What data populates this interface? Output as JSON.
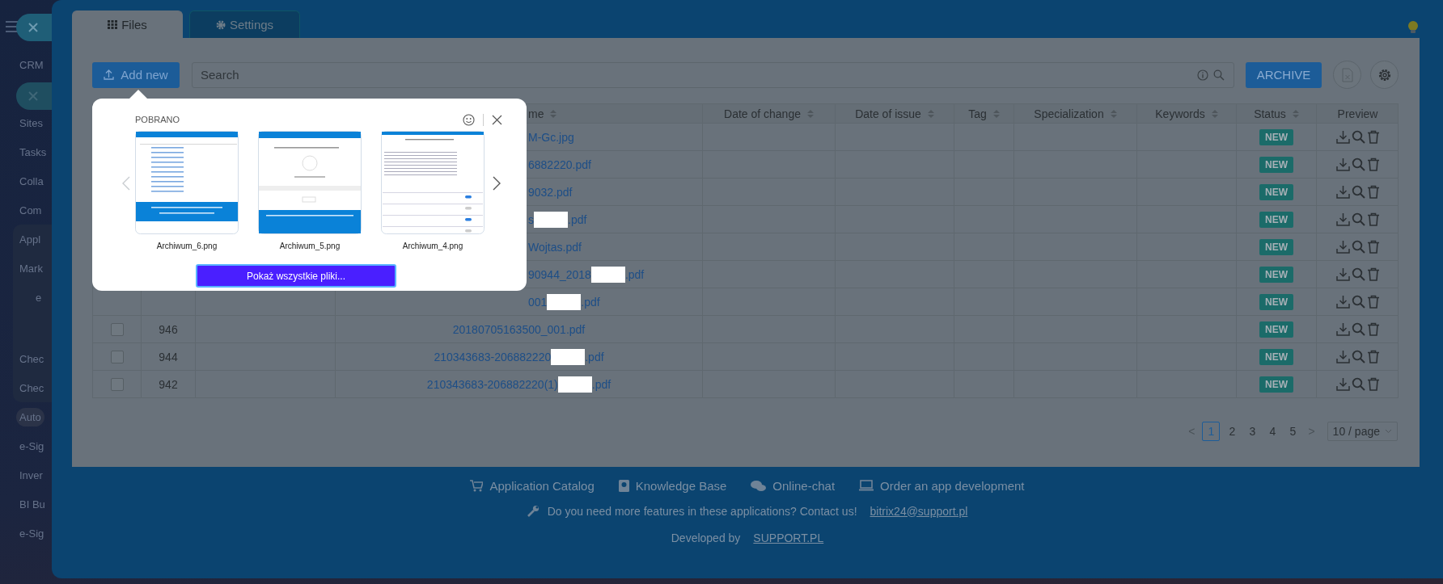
{
  "sidebar": {
    "items": [
      {
        "label": "CRM",
        "selected": false
      },
      {
        "label": "Sites",
        "selected": false
      },
      {
        "label": "Tasks",
        "selected": false
      },
      {
        "label": "Colla",
        "selected": false
      },
      {
        "label": "Com",
        "selected": false
      }
    ],
    "group": [
      {
        "label": "Appl",
        "kind": "item",
        "selected": false
      },
      {
        "label": "Mark",
        "kind": "item",
        "selected": false
      },
      {
        "label": "e",
        "kind": "sub",
        "selected": false
      },
      {
        "label": "Chec",
        "kind": "item",
        "selected": false
      },
      {
        "label": "Chec",
        "kind": "item",
        "selected": false
      }
    ],
    "items_after": [
      {
        "label": "Auto",
        "selected": true
      },
      {
        "label": "e-Sig",
        "selected": false
      },
      {
        "label": "Inver",
        "selected": false
      },
      {
        "label": "BI Bu",
        "selected": false
      },
      {
        "label": "e-Sig",
        "selected": false
      }
    ]
  },
  "tabs": [
    {
      "label": "Files",
      "selected": true
    },
    {
      "label": "Settings",
      "selected": false
    }
  ],
  "toolbar": {
    "add_button": "Add new",
    "search": {
      "placeholder": "Search"
    },
    "archive_button": "ARCHIVE"
  },
  "table": {
    "columns": [
      {
        "label": "me",
        "sortable": true
      },
      {
        "label": "Date of change",
        "sortable": true
      },
      {
        "label": "Date of issue",
        "sortable": true
      },
      {
        "label": "Tag",
        "sortable": true
      },
      {
        "label": "Specialization",
        "sortable": true
      },
      {
        "label": "Keywords",
        "sortable": true
      },
      {
        "label": "Status",
        "sortable": true
      },
      {
        "label": "Preview",
        "sortable": false
      }
    ],
    "rows": [
      {
        "file_name": "M-Gc.jpg",
        "redacted": false,
        "status": "NEW"
      },
      {
        "file_name": "6882220.pdf",
        "redacted": false,
        "status": "NEW"
      },
      {
        "file_name": "9032.pdf",
        "redacted": false,
        "status": "NEW"
      },
      {
        "file_name": "s",
        "redacted": true,
        "file_ext": ".pdf",
        "status": "NEW"
      },
      {
        "file_name": "Wojtas.pdf",
        "redacted": false,
        "status": "NEW"
      },
      {
        "file_name": "90944_2018",
        "redacted": true,
        "file_ext": ".pdf",
        "status": "NEW"
      },
      {
        "file_name": "001",
        "redacted": true,
        "file_ext": ".pdf",
        "status": "NEW"
      },
      {
        "id": "946",
        "checked": false,
        "file_name": "20180705163500_001.pdf",
        "redacted": false,
        "status": "NEW"
      },
      {
        "id": "944",
        "checked": false,
        "file_name": "210343683-206882220",
        "redacted": true,
        "file_ext": ".pdf",
        "status": "NEW"
      },
      {
        "id": "942",
        "checked": false,
        "file_name": "210343683-206882220(1)",
        "redacted": true,
        "file_ext": ".pdf",
        "status": "NEW"
      }
    ]
  },
  "pagination": {
    "prev": "<",
    "pages": [
      {
        "label": "1",
        "selected": true
      },
      {
        "label": "2",
        "selected": false
      },
      {
        "label": "3",
        "selected": false
      },
      {
        "label": "4",
        "selected": false
      },
      {
        "label": "5",
        "selected": false
      }
    ],
    "next": ">",
    "page_size": "10 / page"
  },
  "popup": {
    "title": "POBRANO",
    "files": [
      {
        "name": "Archiwum_6.png",
        "kind": "table"
      },
      {
        "name": "Archiwum_5.png",
        "kind": "license"
      },
      {
        "name": "Archiwum_4.png",
        "kind": "form"
      }
    ],
    "button": "Pokaż wszystkie pliki..."
  },
  "footer": {
    "links": [
      {
        "label": "Application Catalog",
        "kind": "cart"
      },
      {
        "label": "Knowledge Base",
        "kind": "book"
      },
      {
        "label": "Online-chat",
        "kind": "chat"
      },
      {
        "label": "Order an app development",
        "kind": "laptop"
      }
    ],
    "question": "Do you need more features in these applications? Contact us!",
    "email": "bitrix24@support.pl",
    "developed_by": "Developed by",
    "company": "SUPPORT.PL"
  }
}
